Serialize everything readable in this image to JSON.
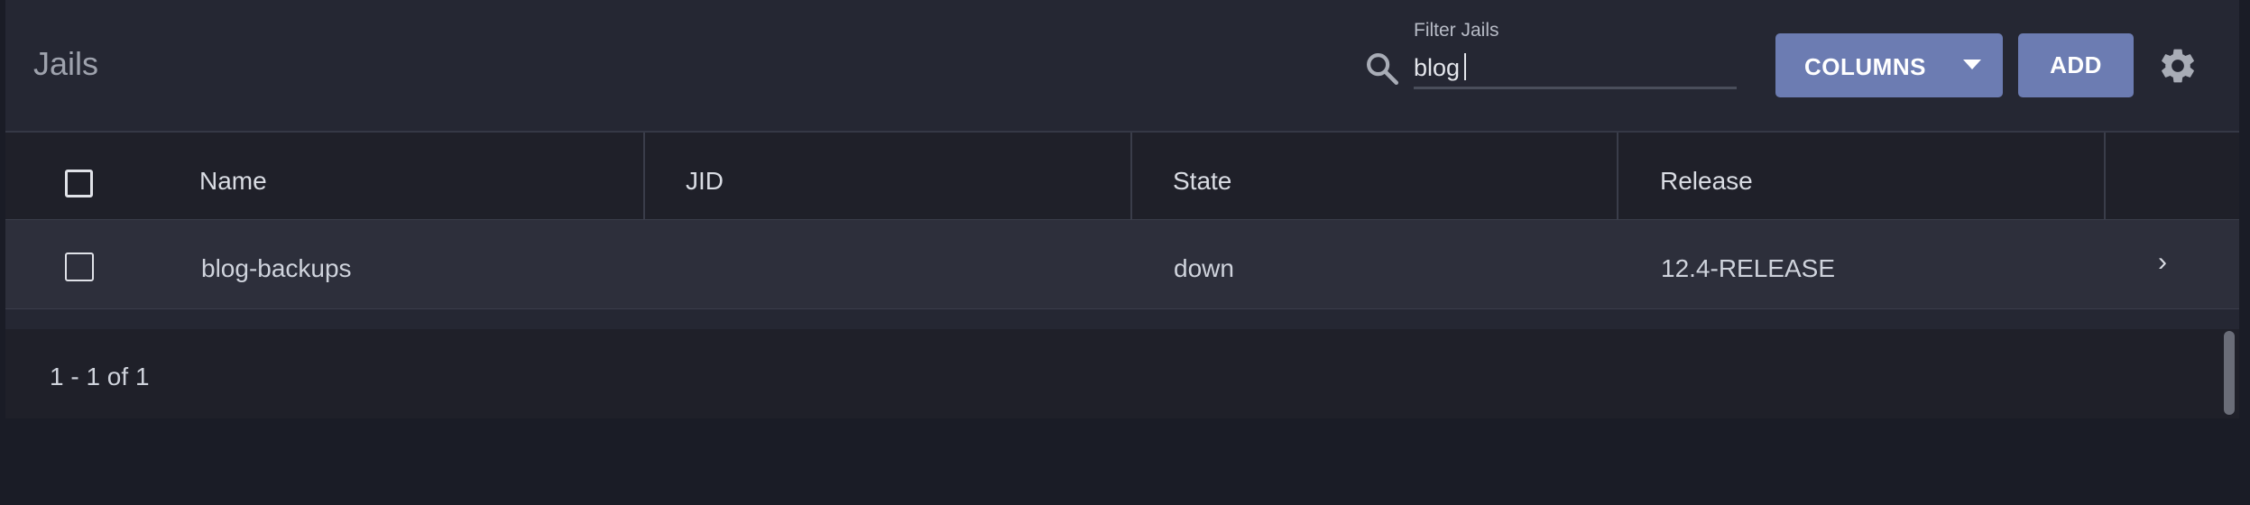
{
  "toolbar": {
    "title": "Jails",
    "filter_label": "Filter Jails",
    "filter_value": "blog",
    "columns_label": "COLUMNS",
    "add_label": "ADD",
    "search_icon": "search-icon",
    "settings_icon": "gear-icon"
  },
  "table": {
    "columns": [
      "Name",
      "JID",
      "State",
      "Release"
    ],
    "rows": [
      {
        "name": "blog-backups",
        "jid": "",
        "state": "down",
        "release": "12.4-RELEASE"
      }
    ]
  },
  "footer": {
    "paging": "1 - 1 of 1"
  },
  "colors": {
    "background": "#1a1c26",
    "card": "#252733",
    "accent": "#6c7cb2"
  }
}
